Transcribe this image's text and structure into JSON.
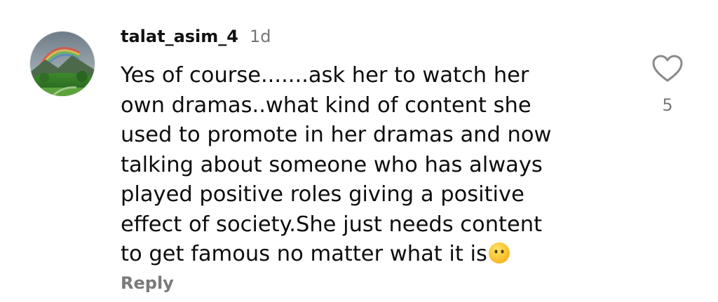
{
  "comment": {
    "username": "talat_asim_4",
    "time": "1d",
    "lines": [
      "Yes of course.......ask her to watch her",
      "own dramas..what kind of content she",
      "used to promote in her dramas and now",
      "talking about someone who has always",
      "played positive roles giving a positive",
      "effect of society.She just needs content",
      "to get famous no matter what it is"
    ],
    "emoji": "face-without-mouth-emoji",
    "reply_label": "Reply",
    "like_icon": "heart-outline-icon",
    "like_count": "5"
  }
}
